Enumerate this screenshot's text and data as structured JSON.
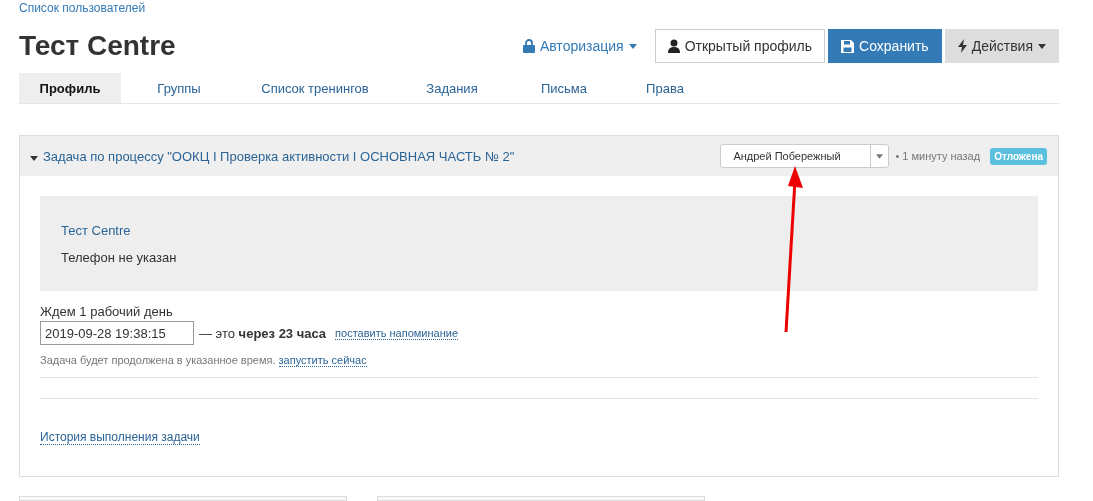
{
  "breadcrumb": "Список пользователей",
  "title": "Тест Centre",
  "auth_menu": {
    "label": "Авторизация"
  },
  "buttons": [
    {
      "label": "Открытый профиль",
      "kind": "default"
    },
    {
      "label": "Сохранить",
      "kind": "primary"
    },
    {
      "label": "Действия",
      "kind": "dropdown"
    }
  ],
  "tabs": [
    {
      "label": "Профиль",
      "selected": true
    },
    {
      "label": "Группы",
      "selected": false
    },
    {
      "label": "Список тренингов",
      "selected": false
    },
    {
      "label": "Задания",
      "selected": false
    },
    {
      "label": "Письма",
      "selected": false
    },
    {
      "label": "Права",
      "selected": false
    }
  ],
  "task": {
    "expanded": true,
    "title": "Задача по процессу \"ООКЦ I Проверка активности I ОСНОВНАЯ ЧАСТЬ № 2\"",
    "assignee": "Андрей Побережный",
    "time": "• 1 минуту назад",
    "status": "Отложена",
    "contact_name": "Тест Centre",
    "phone": "Телефон не указан",
    "wait_label": "Ждем 1 рабочий день",
    "datetime": "2019-09-28 19:38:15",
    "relative": "— это **через 23 часа**",
    "reminder_link": "поставить напоминание",
    "note": "Задача будет продолжена в указанное время.",
    "run_link": "запустить сейчас",
    "history_link": "История выполнения задачи"
  }
}
